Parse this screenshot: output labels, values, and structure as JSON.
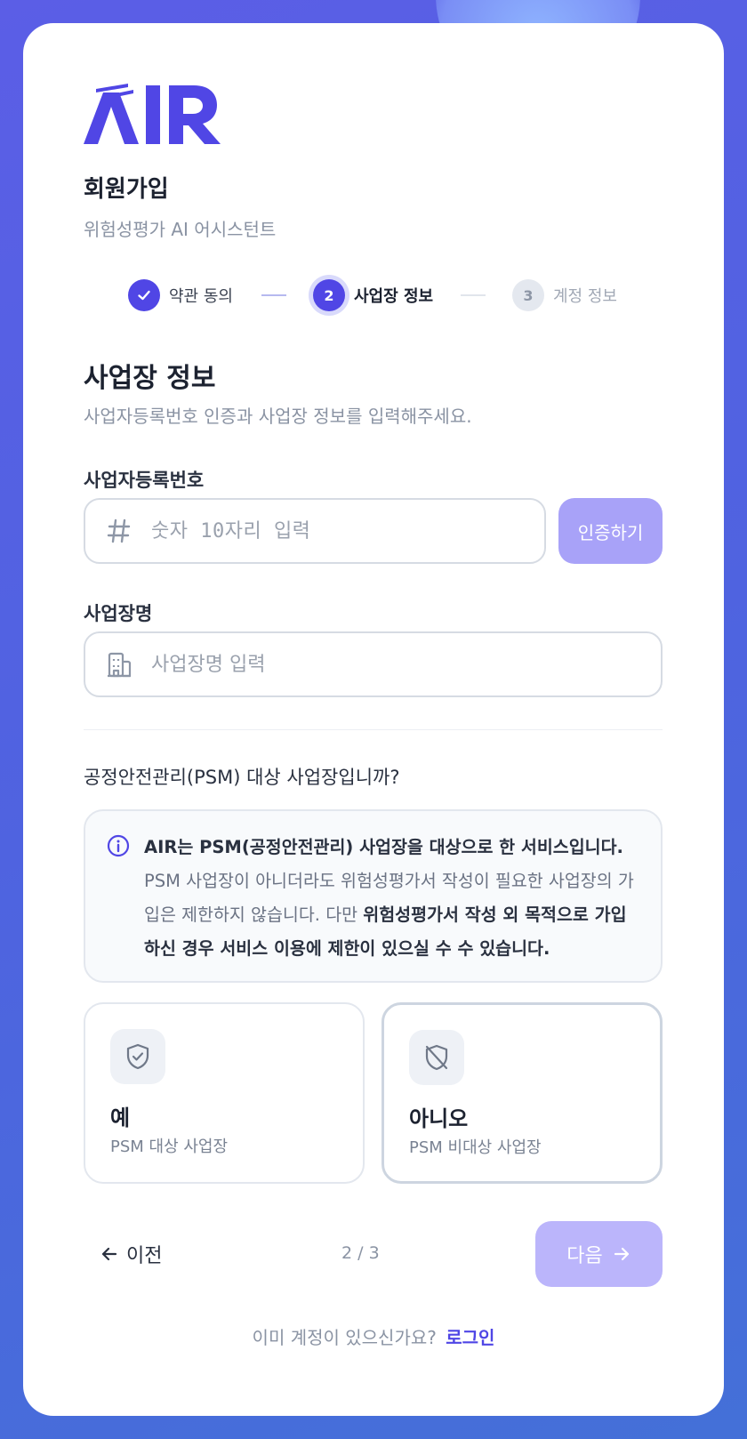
{
  "brand": {
    "logo_text": "AIR",
    "primary_color": "#5046e5"
  },
  "header": {
    "title": "회원가입",
    "subtitle": "위험성평가 AI 어시스턴트"
  },
  "stepper": {
    "steps": [
      {
        "number": "1",
        "label": "약관 동의",
        "state": "completed"
      },
      {
        "number": "2",
        "label": "사업장 정보",
        "state": "active"
      },
      {
        "number": "3",
        "label": "계정 정보",
        "state": "upcoming"
      }
    ]
  },
  "section": {
    "title": "사업장 정보",
    "description": "사업자등록번호 인증과 사업장 정보를 입력해주세요."
  },
  "business_number": {
    "label": "사업자등록번호",
    "placeholder": "숫자 10자리 입력",
    "value": "",
    "icon": "hash-icon",
    "verify_label": "인증하기"
  },
  "business_name": {
    "label": "사업장명",
    "placeholder": "사업장명 입력",
    "value": "",
    "icon": "building-icon"
  },
  "psm": {
    "question": "공정안전관리(PSM) 대상 사업장입니까?",
    "notice": {
      "line1_bold": "AIR는 PSM(공정안전관리) 사업장을 대상으로 한 서비스입니다.",
      "line2": "PSM 사업장이 아니더라도 위험성평가서 작성이 필요한 사업장의 가입은 제한하지 않습니다. 다만 ",
      "line2_bold": "위험성평가서 작성 외 목적으로 가입하신 경우 서비스 이용에 제한이 있으실 수 수 있습니다."
    },
    "options": [
      {
        "title": "예",
        "subtitle": "PSM 대상 사업장",
        "icon": "shield-check-icon"
      },
      {
        "title": "아니오",
        "subtitle": "PSM 비대상 사업장",
        "icon": "shield-off-icon"
      }
    ]
  },
  "footer": {
    "prev_label": "이전",
    "page_indicator": "2 / 3",
    "next_label": "다음",
    "login_prompt": "이미 계정이 있으신가요?",
    "login_link": "로그인"
  }
}
